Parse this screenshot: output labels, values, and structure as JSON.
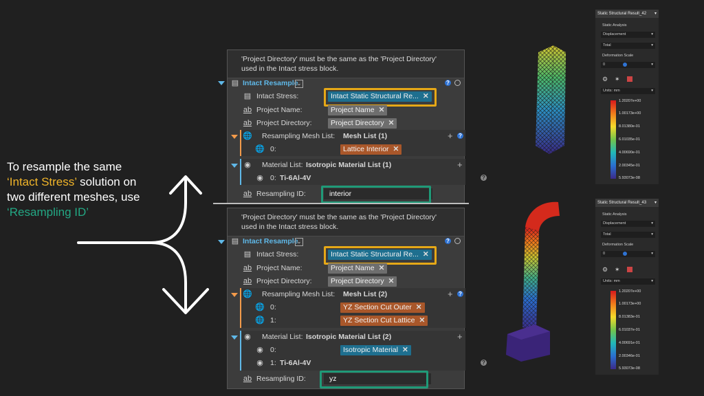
{
  "narrative": {
    "line1": "To resample the same",
    "line2_highlight": "‘Intact Stress’",
    "line2_rest": " solution on",
    "line3": "two different meshes, use",
    "line4_highlight": "‘Resampling ID’"
  },
  "panels": [
    {
      "note_line1": "'Project Directory' must be the same as the 'Project Directory'",
      "note_line2": "used in the Intact stress block.",
      "block_title": "Intact Resample",
      "intact_stress_label": "Intact Stress:",
      "intact_stress_value": "Intact Static Structural Re...",
      "project_name_label": "Project Name:",
      "project_name_value": "Project Name",
      "project_dir_label": "Project Directory:",
      "project_dir_value": "Project Directory",
      "mesh_list_label": "Resampling Mesh List:",
      "mesh_list_value": "Mesh List (1)",
      "meshes": [
        {
          "index": "0:",
          "value": "Lattice Interior"
        }
      ],
      "material_list_label": "Material List:",
      "material_list_value": "Isotropic Material List (1)",
      "materials": [
        {
          "index": "0:",
          "value": "Ti-6Al-4V",
          "style": "link"
        }
      ],
      "resampling_id_label": "Resampling ID:",
      "resampling_id_value": "interior"
    },
    {
      "note_line1": "'Project Directory' must be the same as the 'Project Directory'",
      "note_line2": "used in the Intact stress block.",
      "block_title": "Intact Resample",
      "intact_stress_label": "Intact Stress:",
      "intact_stress_value": "Intact Static Structural Re...",
      "project_name_label": "Project Name:",
      "project_name_value": "Project Name",
      "project_dir_label": "Project Directory:",
      "project_dir_value": "Project Directory",
      "mesh_list_label": "Resampling Mesh List:",
      "mesh_list_value": "Mesh List (2)",
      "meshes": [
        {
          "index": "0:",
          "value": "YZ Section Cut Outer"
        },
        {
          "index": "1:",
          "value": "YZ Section Cut Lattice"
        }
      ],
      "material_list_label": "Material List:",
      "material_list_value": "Isotropic Material List (2)",
      "materials": [
        {
          "index": "0:",
          "value": "Isotropic Material",
          "style": "chip"
        },
        {
          "index": "1:",
          "value": "Ti-6Al-4V",
          "style": "link"
        }
      ],
      "resampling_id_label": "Resampling ID:",
      "resampling_id_value": "yz"
    }
  ],
  "results": [
    {
      "title": "Static Structural Result_42",
      "analysis": "Static Analysis",
      "quantity": "Displacement",
      "component": "Total",
      "deformation_label": "Deformation Scale",
      "deformation_value": "0",
      "units": "Units: mm",
      "ticks": [
        "1.20207e+00",
        "1.00173e+00",
        "8.01380e-01",
        "6.01035e-01",
        "4.00690e-01",
        "2.00345e-01",
        "5.93073e-08"
      ]
    },
    {
      "title": "Static Structural Result_43",
      "analysis": "Static Analysis",
      "quantity": "Displacement",
      "component": "Total",
      "deformation_label": "Deformation Scale",
      "deformation_value": "0",
      "units": "Units: mm",
      "ticks": [
        "1.20207e+00",
        "1.00173e+00",
        "8.01383e-01",
        "6.01037e-01",
        "4.00691e-01",
        "2.00346e-01",
        "5.93073e-08"
      ]
    }
  ],
  "colors": {
    "highlight_yellow": "#f0b429",
    "highlight_green": "#23a884",
    "block_title_blue": "#5fb8e8",
    "mesh_orange": "#f29a4a"
  }
}
